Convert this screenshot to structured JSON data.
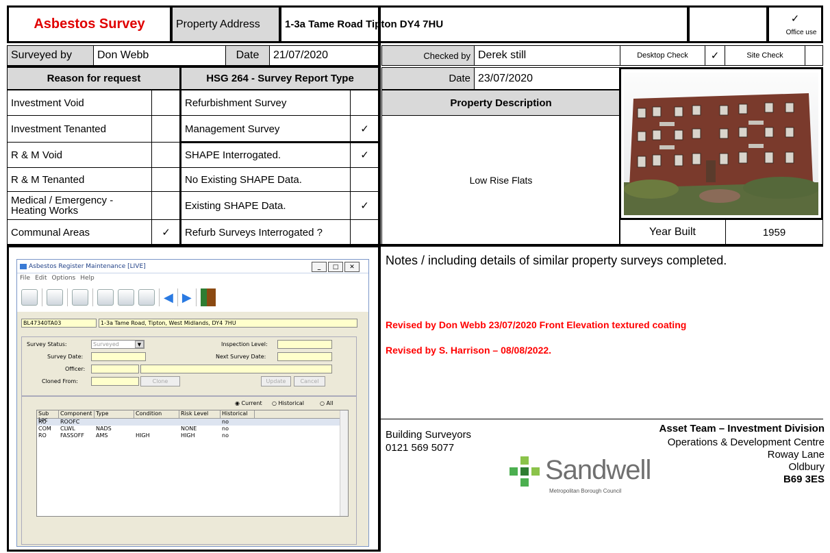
{
  "header": {
    "title": "Asbestos Survey",
    "address_label": "Property Address",
    "address_value": "1-3a Tame Road Tipton DY4 7HU",
    "office_tick": "✓",
    "office_label": "Office use"
  },
  "survey": {
    "surveyed_by_label": "Surveyed by",
    "surveyed_by_value": "Don Webb",
    "date_label": "Date",
    "date_value": "21/07/2020",
    "checked_by_label": "Checked by",
    "checked_by_value": "Derek still",
    "desktop_check_label": "Desktop Check",
    "desktop_check_tick": "✓",
    "site_check_label": "Site Check",
    "site_check_tick": "",
    "checked_date_label": "Date",
    "checked_date_value": "23/07/2020"
  },
  "reason": {
    "header": "Reason for request",
    "items": [
      {
        "label": "Investment Void",
        "tick": ""
      },
      {
        "label": "Investment Tenanted",
        "tick": ""
      },
      {
        "label": "R & M Void",
        "tick": ""
      },
      {
        "label": "R & M Tenanted",
        "tick": ""
      },
      {
        "label": "Medical / Emergency - Heating Works",
        "tick": ""
      },
      {
        "label": "Communal Areas",
        "tick": "✓"
      }
    ]
  },
  "report_type": {
    "header": "HSG 264 - Survey Report Type",
    "items": [
      {
        "label": "Refurbishment Survey",
        "tick": ""
      },
      {
        "label": "Management Survey",
        "tick": "✓"
      },
      {
        "label": "SHAPE Interrogated.",
        "tick": "✓"
      },
      {
        "label": "No Existing SHAPE Data.",
        "tick": ""
      },
      {
        "label": "Existing SHAPE Data.",
        "tick": "✓"
      },
      {
        "label": "Refurb Surveys Interrogated ?",
        "tick": ""
      }
    ]
  },
  "property": {
    "description_header": "Property Description",
    "description_value": "Low Rise Flats",
    "year_built_label": "Year Built",
    "year_built_value": "1959"
  },
  "notes": {
    "heading_bold": "Notes",
    "heading_rest": " / including details of similar property surveys completed.",
    "lines": [
      "Revised by Don Webb 23/07/2020  Front Elevation textured coating",
      "Revised by S. Harrison – 08/08/2022."
    ],
    "color": "#ff0000"
  },
  "footer": {
    "dept": "Building Surveyors",
    "phone": "0121 569 5077",
    "team": "Asset Team – Investment Division",
    "address": [
      "Operations & Development Centre",
      "Roway Lane",
      "Oldbury",
      "B69 3ES"
    ],
    "logo_name": "Sandwell",
    "logo_sub": "Metropolitan Borough Council"
  },
  "app": {
    "title": "Asbestos Register Maintenance [LIVE]",
    "menu": [
      "File",
      "Edit",
      "Options",
      "Help"
    ],
    "ref_code": "BL47340TA03",
    "ref_address": "1-3a Tame Road, Tipton, West Midlands, DY4 7HU",
    "survey_status_label": "Survey Status:",
    "survey_status_value": "Surveyed",
    "inspection_level_label": "Inspection Level:",
    "survey_date_label": "Survey Date:",
    "next_survey_date_label": "Next Survey Date:",
    "officer_label": "Officer:",
    "cloned_from_label": "Cloned From:",
    "clone_btn": "Clone",
    "update_btn": "Update",
    "cancel_btn": "Cancel",
    "radio_current": "Current",
    "radio_historical": "Historical",
    "radio_all": "All",
    "columns": [
      "Sub Loc",
      "Component",
      "Type",
      "Condition",
      "Risk Level",
      "Historical"
    ],
    "rows": [
      [
        "RO",
        "ROOFC",
        "",
        "",
        "",
        "no"
      ],
      [
        "COM",
        "CLWL",
        "NADS",
        "",
        "NONE",
        "no"
      ],
      [
        "RO",
        "FASSOFF",
        "AMS",
        "HIGH",
        "HIGH",
        "no"
      ]
    ]
  }
}
